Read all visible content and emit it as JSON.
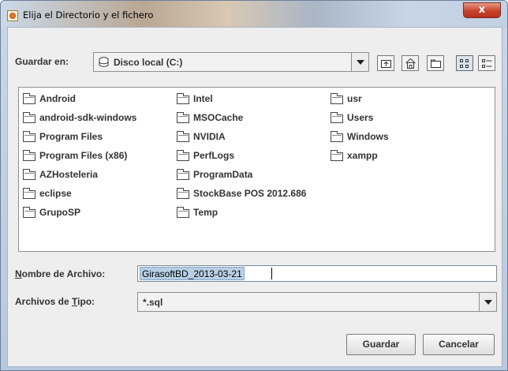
{
  "window": {
    "title": "Elija el Directorio y el fichero",
    "close_glyph": "x"
  },
  "look_in": {
    "label": "Guardar en:",
    "value": "Disco local (C:)",
    "icon": "drive-icon"
  },
  "toolbar": {
    "buttons": [
      {
        "name": "up-one-level",
        "icon": "folder-up-icon"
      },
      {
        "name": "home",
        "icon": "home-icon"
      },
      {
        "name": "new-folder",
        "icon": "new-folder-icon"
      },
      {
        "name": "list-view",
        "icon": "list-view-icon",
        "active": true
      },
      {
        "name": "details-view",
        "icon": "details-view-icon"
      }
    ]
  },
  "files": {
    "column1": [
      "Android",
      "android-sdk-windows",
      "Program Files",
      "Program Files (x86)",
      "AZHosteleria",
      "eclipse",
      "GrupoSP"
    ],
    "column2": [
      "Intel",
      "MSOCache",
      "NVIDIA",
      "PerfLogs",
      "ProgramData",
      "StockBase POS 2012.686",
      "Temp"
    ],
    "column3": [
      "usr",
      "Users",
      "Windows",
      "xampp"
    ]
  },
  "file_name": {
    "label_mnemonic": "N",
    "label_rest": "ombre de Archivo:",
    "value": "GirasoftBD_2013-03-21"
  },
  "file_type": {
    "label_prefix": "Archivos de ",
    "label_mnemonic": "T",
    "label_rest": "ipo:",
    "value": "*.sql"
  },
  "actions": {
    "save": "Guardar",
    "cancel": "Cancelar"
  },
  "colors": {
    "selection": "#b8cfe5",
    "panel": "#eeeeee",
    "close": "#c7402b"
  }
}
